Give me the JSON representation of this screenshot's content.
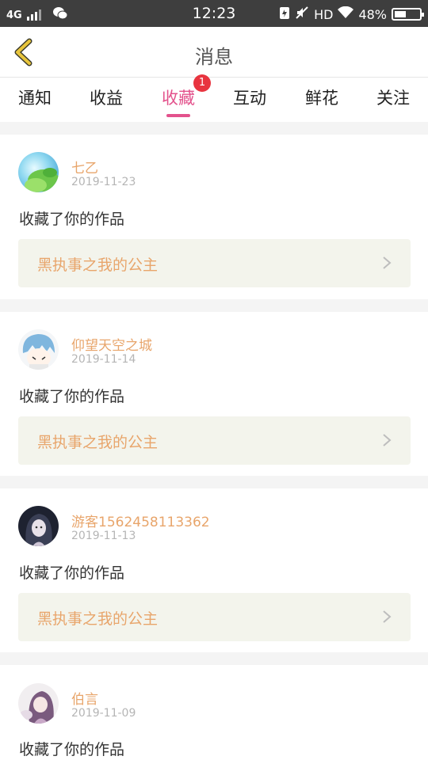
{
  "status_bar": {
    "network": "4G",
    "time": "12:23",
    "hd": "HD",
    "battery": "48%"
  },
  "header": {
    "title": "消息"
  },
  "tabs": [
    {
      "label": "通知"
    },
    {
      "label": "收益"
    },
    {
      "label": "收藏",
      "active": true,
      "badge": "1"
    },
    {
      "label": "互动"
    },
    {
      "label": "鲜花"
    },
    {
      "label": "关注"
    }
  ],
  "messages": [
    {
      "user": "七乙",
      "date": "2019-11-23",
      "action": "收藏了你的作品",
      "work": "黑执事之我的公主",
      "avatar": "green-leaves-avatar"
    },
    {
      "user": "仰望天空之城",
      "date": "2019-11-14",
      "action": "收藏了你的作品",
      "work": "黑执事之我的公主",
      "avatar": "blue-hair-anime-avatar"
    },
    {
      "user": "游客1562458113362",
      "date": "2019-11-13",
      "action": "收藏了你的作品",
      "work": "黑执事之我的公主",
      "avatar": "dark-hair-girl-avatar"
    },
    {
      "user": "伯言",
      "date": "2019-11-09",
      "action": "收藏了你的作品",
      "avatar": "purple-anime-avatar"
    }
  ],
  "colors": {
    "accent_pink": "#e3528c",
    "username_orange": "#e8a56b",
    "back_arrow_yellow": "#e8c53c",
    "badge_red": "#e8343f"
  }
}
